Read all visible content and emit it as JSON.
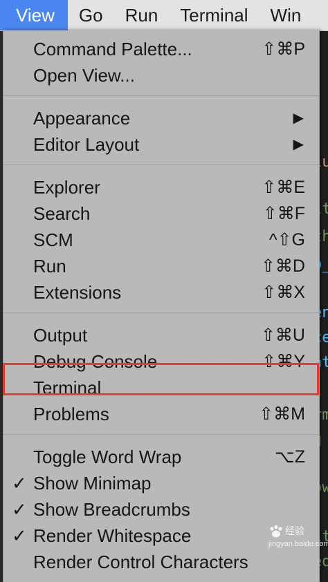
{
  "menubar": {
    "items": [
      {
        "label": "View",
        "active": true
      },
      {
        "label": "Go"
      },
      {
        "label": "Run"
      },
      {
        "label": "Terminal"
      },
      {
        "label": "Win"
      }
    ]
  },
  "menu": {
    "items": [
      {
        "label": "Command Palette...",
        "shortcut": "⇧⌘P"
      },
      {
        "label": "Open View...",
        "shortcut": ""
      },
      {
        "label": "Appearance",
        "submenu": true
      },
      {
        "label": "Editor Layout",
        "submenu": true
      },
      {
        "label": "Explorer",
        "shortcut": "⇧⌘E"
      },
      {
        "label": "Search",
        "shortcut": "⇧⌘F"
      },
      {
        "label": "SCM",
        "shortcut": "^⇧G"
      },
      {
        "label": "Run",
        "shortcut": "⇧⌘D"
      },
      {
        "label": "Extensions",
        "shortcut": "⇧⌘X"
      },
      {
        "label": "Output",
        "shortcut": "⇧⌘U"
      },
      {
        "label": "Debug Console",
        "shortcut": "⇧⌘Y"
      },
      {
        "label": "Terminal",
        "shortcut": "",
        "highlighted": true
      },
      {
        "label": "Problems",
        "shortcut": "⇧⌘M"
      },
      {
        "label": "Toggle Word Wrap",
        "shortcut": "⌥Z"
      },
      {
        "label": "Show Minimap",
        "checked": true,
        "check": "✓"
      },
      {
        "label": "Show Breadcrumbs",
        "checked": true,
        "check": "✓"
      },
      {
        "label": "Render Whitespace",
        "checked": true,
        "check": "✓"
      },
      {
        "label": "Render Control Characters"
      }
    ],
    "submenu_arrow": "▶"
  },
  "background_code": [
    {
      "text": "lu",
      "color": "#ce9178"
    },
    {
      "text": "lt",
      "color": "#6a9955"
    },
    {
      "text": "th",
      "color": "#6a9955"
    },
    {
      "text": "p_",
      "color": "#4fc1ff"
    },
    {
      "text": "en",
      "color": "#4fc1ff"
    },
    {
      "text": "ce",
      "color": "#4fc1ff"
    },
    {
      "text": "nt",
      "color": "#4fc1ff"
    },
    {
      "text": "rm",
      "color": "#6a9955"
    },
    {
      "text": "g",
      "color": "#6a9955"
    },
    {
      "text": "ow",
      "color": "#6a9955"
    },
    {
      "text": "lt",
      "color": "#6a9955"
    },
    {
      "text": "ed",
      "color": "#6a9955"
    }
  ],
  "watermark": {
    "text": "经验",
    "sub": "jingyan.baidu.com"
  },
  "colors": {
    "accent": "#4a87f0",
    "highlight_box": "#e53a2e",
    "menu_bg": "#b9b9b9"
  }
}
